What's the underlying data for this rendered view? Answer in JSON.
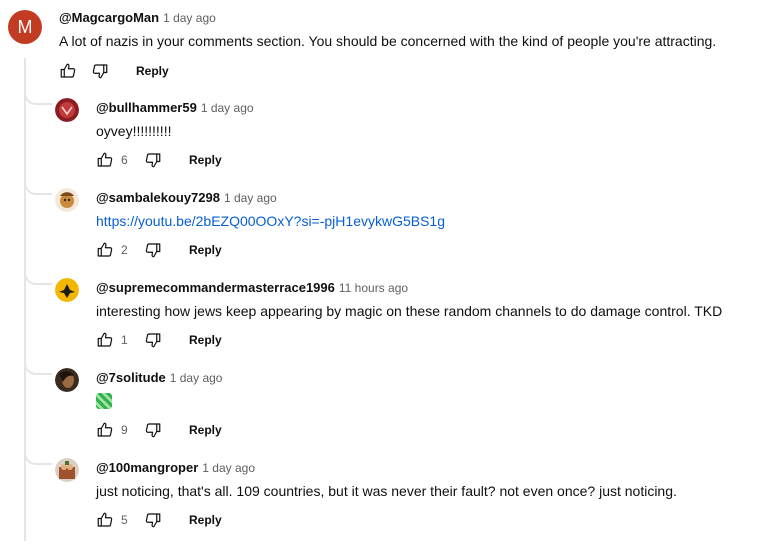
{
  "main_comment": {
    "avatar_letter": "M",
    "author": "@MagcargoMan",
    "time": "1 day ago",
    "text": "A lot of nazis in your comments section. You should be concerned with the kind of people you're attracting.",
    "reply_label": "Reply",
    "avatar_color": "#c13c22"
  },
  "replies": [
    {
      "author": "@bullhammer59",
      "time": "1 day ago",
      "text": "oyvey!!!!!!!!!!",
      "likes": "6",
      "reply_label": "Reply"
    },
    {
      "author": "@sambalekouy7298",
      "time": "1 day ago",
      "text": "https://youtu.be/2bEZQ00OOxY?si=-pjH1evykwG5BS1g",
      "likes": "2",
      "reply_label": "Reply"
    },
    {
      "author": "@supremecommandermasterrace1996",
      "time": "11 hours ago",
      "text": "interesting how jews keep appearing by magic on these random channels to do damage control. TKD",
      "likes": "1",
      "reply_label": "Reply"
    },
    {
      "author": "@7solitude",
      "time": "1 day ago",
      "text": "",
      "likes": "9",
      "reply_label": "Reply"
    },
    {
      "author": "@100mangroper",
      "time": "1 day ago",
      "text": "just noticing, that's all. 109 countries, but it was never their fault? not even once? just noticing.",
      "likes": "5",
      "reply_label": "Reply"
    }
  ],
  "colors": {
    "link": "#065fd4",
    "muted": "#606060",
    "text": "#0f0f0f",
    "thread_line": "#e5e5e5"
  }
}
